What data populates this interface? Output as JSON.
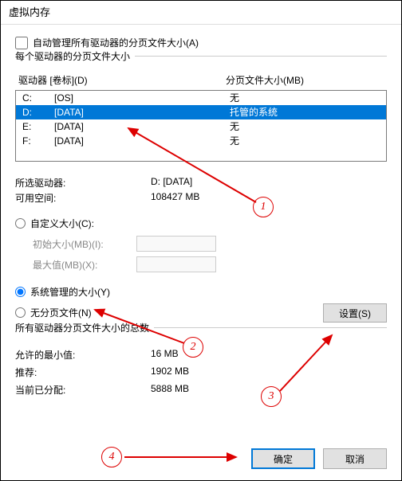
{
  "title": "虚拟内存",
  "auto_manage_label": "自动管理所有驱动器的分页文件大小(A)",
  "auto_manage_checked": false,
  "section_each_drive": "每个驱动器的分页文件大小",
  "columns": {
    "drive": "驱动器 [卷标](D)",
    "size": "分页文件大小(MB)"
  },
  "drives": [
    {
      "letter": "C:",
      "label": "[OS]",
      "size": "无",
      "selected": false
    },
    {
      "letter": "D:",
      "label": "[DATA]",
      "size": "托管的系统",
      "selected": true
    },
    {
      "letter": "E:",
      "label": "[DATA]",
      "size": "无",
      "selected": false
    },
    {
      "letter": "F:",
      "label": "[DATA]",
      "size": "无",
      "selected": false
    }
  ],
  "selected_drive_label": "所选驱动器:",
  "selected_drive_value": "D:  [DATA]",
  "available_space_label": "可用空间:",
  "available_space_value": "108427 MB",
  "radio_custom": "自定义大小(C):",
  "initial_size_label": "初始大小(MB)(I):",
  "max_size_label": "最大值(MB)(X):",
  "radio_system": "系统管理的大小(Y)",
  "radio_none": "无分页文件(N)",
  "set_button": "设置(S)",
  "section_totals": "所有驱动器分页文件大小的总数",
  "min_allowed_label": "允许的最小值:",
  "min_allowed_value": "16 MB",
  "recommended_label": "推荐:",
  "recommended_value": "1902 MB",
  "allocated_label": "当前已分配:",
  "allocated_value": "5888 MB",
  "ok_button": "确定",
  "cancel_button": "取消",
  "annotations": {
    "a1": "1",
    "a2": "2",
    "a3": "3",
    "a4": "4"
  }
}
